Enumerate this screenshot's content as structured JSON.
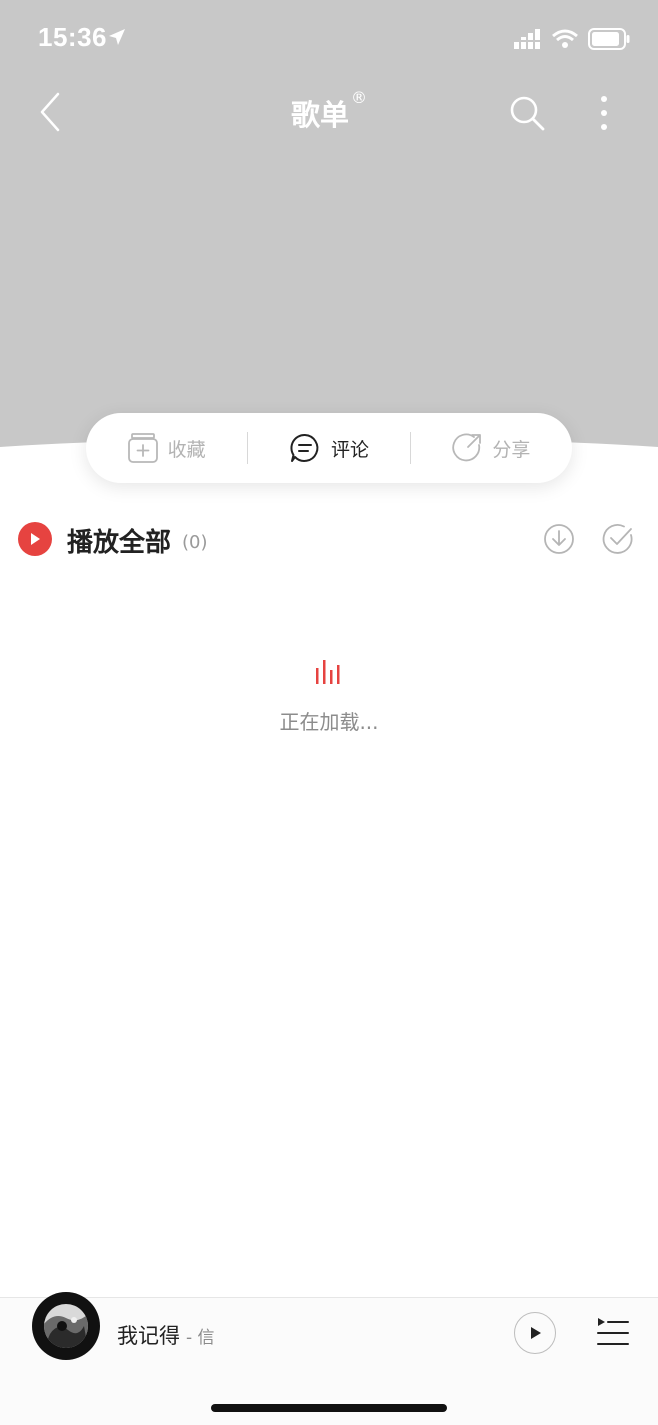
{
  "status_bar": {
    "time": "15:36"
  },
  "nav": {
    "title": "歌单",
    "title_mark": "®"
  },
  "actions": [
    {
      "label": "收藏",
      "icon": "add-collect-icon",
      "state": "disabled"
    },
    {
      "label": "评论",
      "icon": "comment-icon",
      "state": "active"
    },
    {
      "label": "分享",
      "icon": "share-icon",
      "state": "disabled"
    }
  ],
  "play_all": {
    "label": "播放全部",
    "count": "(0)"
  },
  "loading": {
    "text": "正在加载..."
  },
  "mini_player": {
    "song": "我记得",
    "artist": "- 信"
  },
  "colors": {
    "accent": "#e64340",
    "header_bg": "#c8c8c8"
  }
}
